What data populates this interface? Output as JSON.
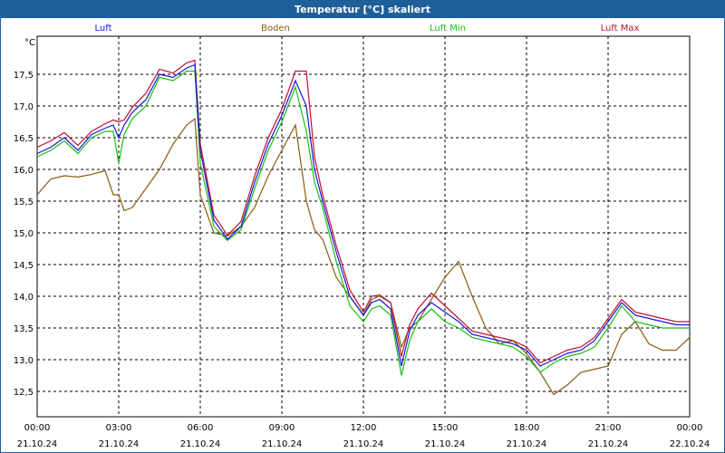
{
  "window": {
    "title": "Temperatur [°C] skaliert"
  },
  "colors": {
    "Luft": "#1818d8",
    "Boden": "#8a5a14",
    "Luft Min": "#18c018",
    "Luft Max": "#c01030",
    "grid": "#000000",
    "titlebar": "#1f5f99"
  },
  "chart_data": {
    "type": "line",
    "title": "Temperatur [°C] skaliert",
    "ylabel": "°C",
    "xlabel": "",
    "ylim": [
      12.1,
      18.1
    ],
    "xlim": [
      0,
      24
    ],
    "grid": true,
    "legend_position": "top",
    "y_ticks": [
      "12,5",
      "13,0",
      "13,5",
      "14,0",
      "14,5",
      "15,0",
      "15,5",
      "16,0",
      "16,5",
      "17,0",
      "17,5"
    ],
    "y_tick_values": [
      12.5,
      13.0,
      13.5,
      14.0,
      14.5,
      15.0,
      15.5,
      16.0,
      16.5,
      17.0,
      17.5
    ],
    "x_ticks": [
      {
        "time": "00:00",
        "date": "21.10.24",
        "h": 0
      },
      {
        "time": "03:00",
        "date": "21.10.24",
        "h": 3
      },
      {
        "time": "06:00",
        "date": "21.10.24",
        "h": 6
      },
      {
        "time": "09:00",
        "date": "21.10.24",
        "h": 9
      },
      {
        "time": "12:00",
        "date": "21.10.24",
        "h": 12
      },
      {
        "time": "15:00",
        "date": "21.10.24",
        "h": 15
      },
      {
        "time": "18:00",
        "date": "21.10.24",
        "h": 18
      },
      {
        "time": "21:00",
        "date": "21.10.24",
        "h": 21
      },
      {
        "time": "00:00",
        "date": "22.10.24",
        "h": 24
      }
    ],
    "x": [
      0,
      0.5,
      1,
      1.5,
      2,
      2.5,
      2.8,
      3,
      3.2,
      3.5,
      4,
      4.5,
      5,
      5.5,
      5.8,
      6,
      6.5,
      7,
      7.5,
      8,
      8.5,
      9,
      9.5,
      9.9,
      10.2,
      10.5,
      11,
      11.5,
      12,
      12.3,
      12.6,
      13,
      13.4,
      13.7,
      14,
      14.5,
      15,
      15.5,
      16,
      16.5,
      17,
      17.5,
      18,
      18.5,
      19,
      19.5,
      20,
      20.5,
      21,
      21.5,
      22,
      22.5,
      23,
      23.5,
      24
    ],
    "series": [
      {
        "name": "Luft",
        "color": "#1818d8",
        "values": [
          16.25,
          16.35,
          16.5,
          16.3,
          16.55,
          16.65,
          16.7,
          16.5,
          16.7,
          16.9,
          17.1,
          17.5,
          17.45,
          17.6,
          17.65,
          16.3,
          15.2,
          14.9,
          15.1,
          15.8,
          16.4,
          16.85,
          17.4,
          17.0,
          16.0,
          15.5,
          14.7,
          14.0,
          13.7,
          13.9,
          13.95,
          13.8,
          12.9,
          13.45,
          13.7,
          13.9,
          13.75,
          13.6,
          13.4,
          13.35,
          13.3,
          13.25,
          13.15,
          12.9,
          13.0,
          13.1,
          13.15,
          13.3,
          13.6,
          13.9,
          13.7,
          13.65,
          13.6,
          13.55,
          13.55
        ]
      },
      {
        "name": "Boden",
        "color": "#8a5a14",
        "values": [
          15.6,
          15.85,
          15.9,
          15.88,
          15.92,
          15.98,
          15.6,
          15.6,
          15.35,
          15.4,
          15.7,
          16.0,
          16.4,
          16.7,
          16.8,
          15.6,
          15.0,
          14.95,
          15.1,
          15.4,
          15.9,
          16.3,
          16.7,
          15.5,
          15.05,
          14.9,
          14.3,
          14.0,
          13.7,
          13.95,
          14.0,
          13.9,
          13.2,
          13.5,
          13.6,
          13.95,
          14.3,
          14.55,
          14.0,
          13.5,
          13.25,
          13.3,
          13.1,
          12.8,
          12.45,
          12.6,
          12.8,
          12.85,
          12.9,
          13.4,
          13.6,
          13.25,
          13.15,
          13.15,
          13.35
        ]
      },
      {
        "name": "Luft Min",
        "color": "#18c018",
        "values": [
          16.2,
          16.3,
          16.45,
          16.25,
          16.5,
          16.6,
          16.6,
          16.1,
          16.55,
          16.8,
          17.0,
          17.45,
          17.4,
          17.55,
          17.55,
          16.1,
          15.1,
          14.88,
          15.05,
          15.7,
          16.3,
          16.75,
          17.3,
          16.6,
          15.8,
          15.4,
          14.55,
          13.85,
          13.6,
          13.8,
          13.85,
          13.7,
          12.75,
          13.3,
          13.6,
          13.8,
          13.6,
          13.5,
          13.35,
          13.3,
          13.25,
          13.2,
          13.05,
          12.8,
          12.95,
          13.05,
          13.1,
          13.2,
          13.5,
          13.85,
          13.6,
          13.55,
          13.5,
          13.5,
          13.5
        ]
      },
      {
        "name": "Luft Max",
        "color": "#c01030",
        "values": [
          16.35,
          16.45,
          16.58,
          16.38,
          16.6,
          16.72,
          16.78,
          16.75,
          16.78,
          16.98,
          17.2,
          17.58,
          17.52,
          17.68,
          17.72,
          16.4,
          15.28,
          14.96,
          15.18,
          15.9,
          16.5,
          16.95,
          17.55,
          17.55,
          16.2,
          15.6,
          14.8,
          14.1,
          13.75,
          14.0,
          14.02,
          13.9,
          13.05,
          13.55,
          13.8,
          14.05,
          13.85,
          13.65,
          13.45,
          13.4,
          13.35,
          13.3,
          13.2,
          12.95,
          13.05,
          13.15,
          13.2,
          13.35,
          13.65,
          13.95,
          13.75,
          13.7,
          13.65,
          13.6,
          13.6
        ]
      }
    ]
  }
}
